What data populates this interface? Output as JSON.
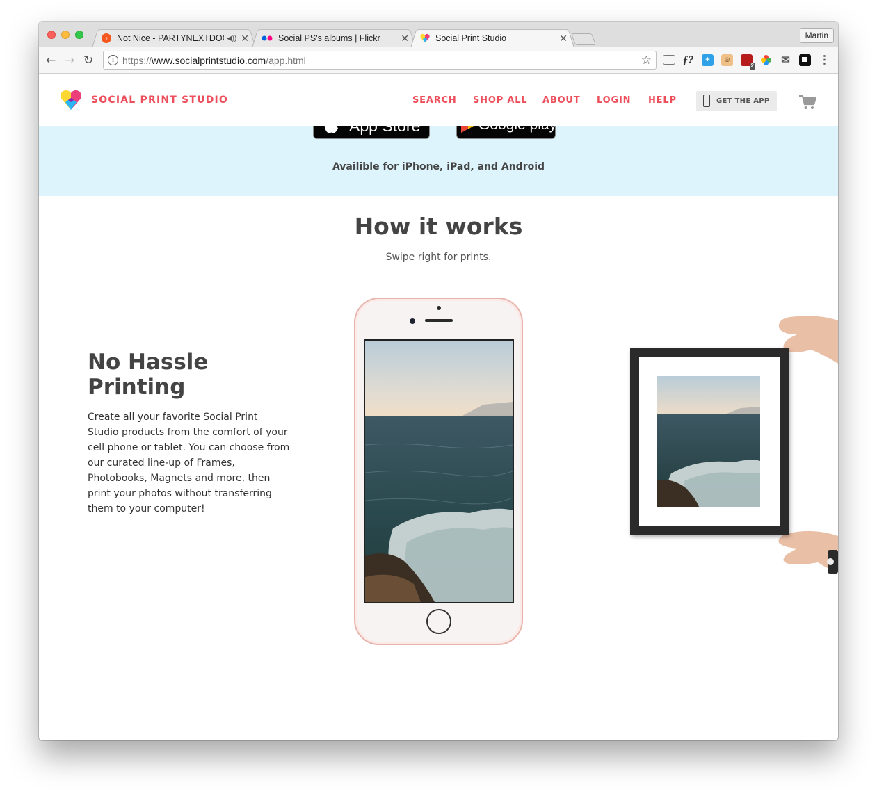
{
  "browser": {
    "tabs": [
      {
        "title": "Not Nice - PARTYNEXTDOO",
        "favicon_color": "#f4561e",
        "active": false
      },
      {
        "title": "Social PS's albums | Flickr",
        "active": false
      },
      {
        "title": "Social Print Studio",
        "active": true
      }
    ],
    "profile_name": "Martin",
    "url_scheme": "https://",
    "url_host": "www.socialprintstudio.com",
    "url_path": "/app.html",
    "extensions_badge": "2"
  },
  "site": {
    "brand": "SOCIAL PRINT STUDIO",
    "nav": [
      {
        "label": "SEARCH"
      },
      {
        "label": "SHOP ALL"
      },
      {
        "label": "ABOUT"
      },
      {
        "label": "LOGIN"
      },
      {
        "label": "HELP"
      }
    ],
    "get_app_label": "GET THE APP",
    "accent_color": "#ec4f5b"
  },
  "banner": {
    "app_store_label": "App Store",
    "google_play_label": "Google play",
    "availability_text": "Availible for iPhone, iPad, and Android",
    "background_color": "#ddf4fd"
  },
  "how_it_works": {
    "title": "How it works",
    "subtitle": "Swipe right for prints.",
    "feature": {
      "title": "No Hassle Printing",
      "body": "Create all your favorite Social Print Studio products from the comfort of your cell phone or tablet. You can choose from our curated line-up of Frames, Photobooks, Magnets and more, then print your photos without transferring them to your computer!"
    }
  }
}
